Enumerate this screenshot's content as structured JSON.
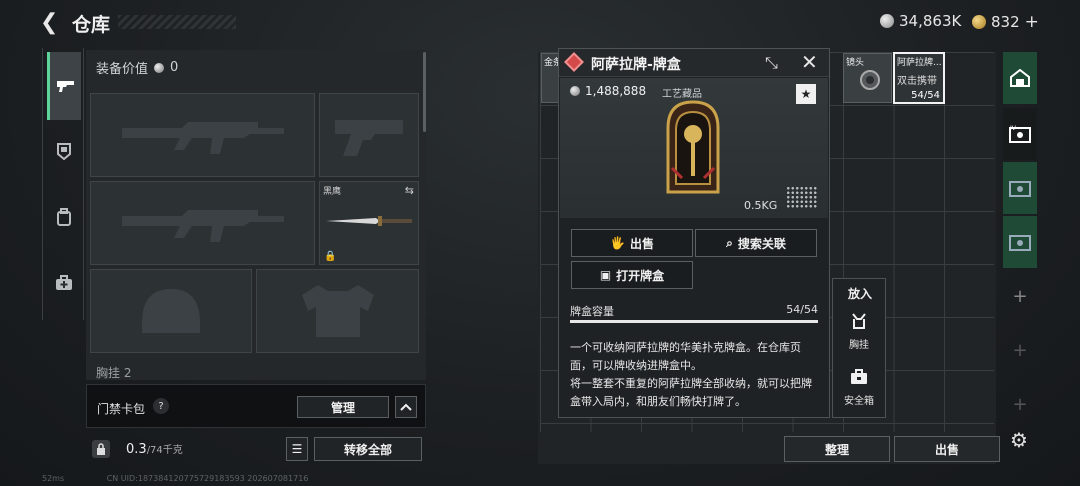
{
  "header": {
    "title": "仓库",
    "silver_amount": "34,863K",
    "gold_amount": "832",
    "add": "+"
  },
  "left_rail": {
    "items": [
      "pistol-icon",
      "armor-icon",
      "backpack-icon",
      "medkit-icon"
    ]
  },
  "equipment": {
    "value_label": "装备价值",
    "value_amount": "0",
    "knife_slot_label": "黑鹰",
    "chest_label": "胸挂 2"
  },
  "card_pack": {
    "label": "门禁卡包",
    "help": "?",
    "manage_label": "管理"
  },
  "weight": {
    "current": "0.3",
    "max": "/74千克",
    "transfer_label": "转移全部"
  },
  "status_bar": {
    "ping": "52ms",
    "uid": "CN UID:18738412077572918359​3  202607081716"
  },
  "inventory": {
    "items": [
      {
        "label": "金条",
        "sub": "",
        "count": ""
      },
      {
        "label": "镜头",
        "sub": "",
        "count": ""
      },
      {
        "label": "阿萨拉牌...",
        "sub": "双击携带",
        "count": "54/54"
      }
    ],
    "sort_label": "整理",
    "sell_label": "出售"
  },
  "popup": {
    "title": "阿萨拉牌-牌盒",
    "value": "1,488,888",
    "category": "工艺藏品",
    "star": "★",
    "weight": "0.5KG",
    "sell_label": "出售",
    "search_label": "搜索关联",
    "open_label": "打开牌盒",
    "capacity_label": "牌盒容量",
    "capacity_value": "54/54",
    "capacity_fill": 1.0,
    "desc_1": "一个可收纳阿萨拉牌的华美扑克牌盒。在仓库页面，可以牌收纳进牌盒中。",
    "desc_2": "将一整套不重复的阿萨拉牌全部收纳，就可以把牌盒带入局内，和朋友们畅快打牌了。"
  },
  "put_in": {
    "title": "放入",
    "chest_rig": "胸挂",
    "safe_box": "安全箱"
  },
  "colors": {
    "accent_green": "#5fd49a",
    "rarity_red": "#d24a4a",
    "panel_green": "#1f4a36"
  }
}
